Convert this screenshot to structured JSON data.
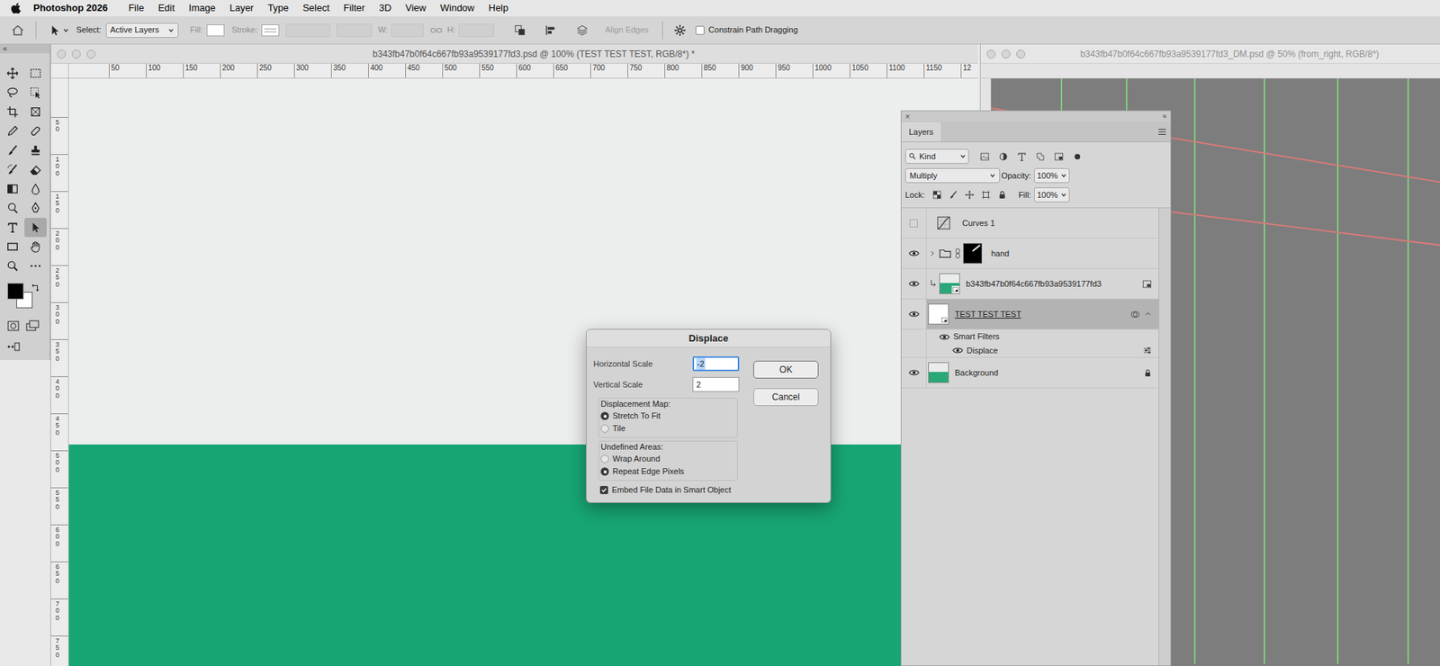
{
  "menubar": {
    "app": "Photoshop 2026",
    "items": [
      "File",
      "Edit",
      "Image",
      "Layer",
      "Type",
      "Select",
      "Filter",
      "3D",
      "View",
      "Window",
      "Help"
    ]
  },
  "options_bar": {
    "select_label": "Select:",
    "select_value": "Active Layers",
    "fill_label": "Fill:",
    "stroke_label": "Stroke:",
    "w": {
      "label": "W:",
      "disabled": true
    },
    "h": {
      "label": "H:",
      "disabled": true
    },
    "align_edges": {
      "label": "Align Edges",
      "disabled": true
    },
    "constrain": {
      "label": "Constrain Path Dragging",
      "checked": false
    }
  },
  "toolbar": {
    "collapse": "«",
    "tools": [
      {
        "kind": "move",
        "selected": false
      },
      {
        "kind": "marquee",
        "selected": false
      },
      {
        "kind": "lasso",
        "selected": false
      },
      {
        "kind": "objectselect",
        "selected": false
      },
      {
        "kind": "crop",
        "selected": false
      },
      {
        "kind": "frame",
        "selected": false
      },
      {
        "kind": "eyedropper",
        "selected": false
      },
      {
        "kind": "heal",
        "selected": false
      },
      {
        "kind": "brush",
        "selected": false
      },
      {
        "kind": "stamp",
        "selected": false
      },
      {
        "kind": "historybrush",
        "selected": false
      },
      {
        "kind": "eraser",
        "selected": false
      },
      {
        "kind": "gradient",
        "selected": false
      },
      {
        "kind": "blur",
        "selected": false
      },
      {
        "kind": "dodge",
        "selected": false
      },
      {
        "kind": "pen",
        "selected": false
      },
      {
        "kind": "type",
        "selected": false
      },
      {
        "kind": "pathselect",
        "selected": true
      },
      {
        "kind": "rectangle",
        "selected": false
      },
      {
        "kind": "hand",
        "selected": false
      },
      {
        "kind": "zoom",
        "selected": false
      },
      {
        "kind": "more",
        "selected": false
      }
    ],
    "swatches": [
      {
        "color": "#000000"
      },
      {
        "color": "#ffffff"
      }
    ]
  },
  "documents": [
    {
      "title": "b343fb47b0f64c667fb93a9539177fd3.psd @ 100% (TEST TEST TEST, RGB/8*) *",
      "active": true,
      "h_ruler": [
        "50",
        "100",
        "150",
        "200",
        "250",
        "300",
        "350",
        "400",
        "450",
        "500",
        "550",
        "600",
        "650",
        "700",
        "750",
        "800",
        "850",
        "900",
        "950",
        "1000",
        "1050",
        "1100",
        "1150",
        "12"
      ],
      "v_ruler": [
        "50",
        "100",
        "150",
        "200",
        "250",
        "300",
        "350",
        "400",
        "450",
        "500",
        "550",
        "600",
        "650",
        "700",
        "750"
      ]
    },
    {
      "title": "b343fb47b0f64c667fb93a9539177fd3_DM.psd @ 50% (from_right, RGB/8*)",
      "active": false
    }
  ],
  "layers_panel": {
    "close": "×",
    "collapse": "«",
    "title": "Layers",
    "filter": "Kind",
    "blend_mode": "Multiply",
    "opacity_label": "Opacity:",
    "opacity": "100%",
    "lock_label": "Lock:",
    "fill_label": "Fill:",
    "fill": "100%",
    "layers": [
      {
        "name": "Curves 1",
        "kind": "adjustment",
        "visible": false,
        "selected": false
      },
      {
        "name": "hand",
        "kind": "group",
        "visible": true,
        "selected": false,
        "expanded": false
      },
      {
        "name": "b343fb47b0f64c667fb93a9539177fd3",
        "kind": "smart",
        "visible": true,
        "selected": false,
        "clipped": true
      },
      {
        "name": "TEST TEST TEST",
        "kind": "smart",
        "visible": true,
        "selected": true,
        "expanded": true
      },
      {
        "name": "Smart Filters",
        "kind": "filters",
        "visible": true,
        "selected": false
      },
      {
        "name": "Displace",
        "kind": "filter",
        "visible": true,
        "selected": false
      },
      {
        "name": "Background",
        "kind": "background",
        "visible": true,
        "selected": false,
        "locked": true
      }
    ]
  },
  "dialog": {
    "title": "Displace",
    "fields": [
      {
        "label": "Horizontal Scale",
        "value": "-2",
        "focused": true
      },
      {
        "label": "Vertical Scale",
        "value": "2",
        "focused": false
      }
    ],
    "groups": [
      {
        "title": "Displacement Map:",
        "options": [
          {
            "label": "Stretch To Fit",
            "selected": true
          },
          {
            "label": "Tile",
            "selected": false
          }
        ]
      },
      {
        "title": "Undefined Areas:",
        "options": [
          {
            "label": "Wrap Around",
            "selected": false
          },
          {
            "label": "Repeat Edge Pixels",
            "selected": true
          }
        ]
      }
    ],
    "embed": {
      "label": "Embed File Data in Smart Object",
      "checked": true
    },
    "buttons": [
      {
        "label": "OK",
        "default": true
      },
      {
        "label": "Cancel",
        "default": false
      }
    ]
  }
}
